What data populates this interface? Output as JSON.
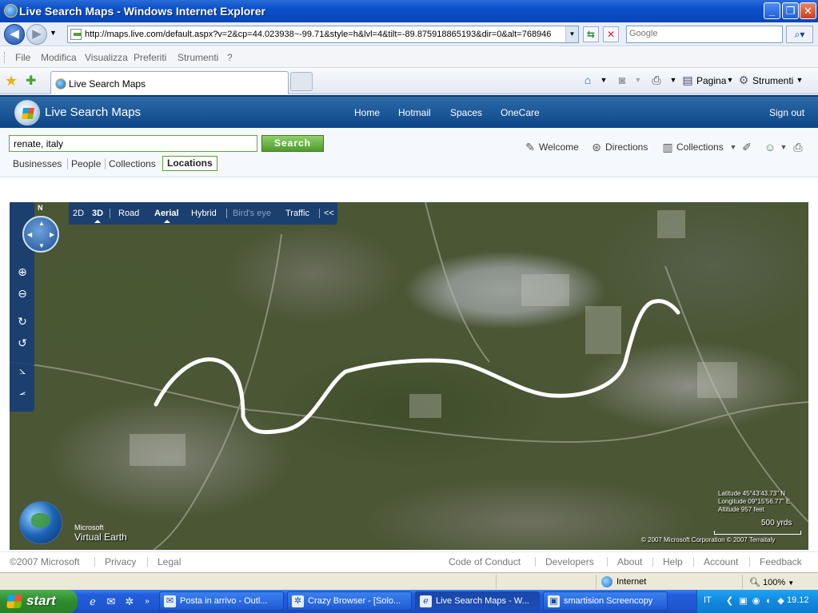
{
  "window": {
    "title": "Live Search Maps - Windows Internet Explorer",
    "minimize": "_",
    "restore": "❐",
    "close": "✕"
  },
  "address_bar": {
    "url": "http://maps.live.com/default.aspx?v=2&cp=44.023938~-99.71&style=h&lvl=4&tilt=-89.875918865193&dir=0&alt=768946",
    "search_placeholder": "Google"
  },
  "menu": [
    "File",
    "Modifica",
    "Visualizza",
    "Preferiti",
    "Strumenti",
    "?"
  ],
  "tab": {
    "label": "Live Search Maps"
  },
  "command_bar": {
    "page_label": "Pagina",
    "tools_label": "Strumenti"
  },
  "site": {
    "title": "Live Search Maps",
    "nav": [
      "Home",
      "Hotmail",
      "Spaces",
      "OneCare"
    ],
    "sign_out": "Sign out"
  },
  "search": {
    "query": "renate, italy",
    "button_label": "Search",
    "filters": [
      "Businesses",
      "People",
      "Collections"
    ],
    "active_filter": "Locations"
  },
  "tools": {
    "welcome": "Welcome",
    "directions": "Directions",
    "collections": "Collections"
  },
  "map": {
    "north": "N",
    "modes": {
      "view_2d": "2D",
      "view_3d": "3D",
      "road": "Road",
      "aerial": "Aerial",
      "hybrid": "Hybrid",
      "birds_eye": "Bird's eye",
      "traffic": "Traffic",
      "collapse": "<<"
    },
    "latitude": "Latitude 45°43'43.73\" N",
    "longitude": "Longitude 09°15'56.77\" E",
    "altitude": "Altitude 957 feet",
    "scale": "500 yrds",
    "copyright": "© 2007 Microsoft Corporation  © 2007 Terraitaly",
    "logo_microsoft": "Microsoft",
    "logo_name": "Virtual Earth"
  },
  "footer": {
    "copyright": "©2007 Microsoft",
    "left_links": [
      "Privacy",
      "Legal"
    ],
    "right_links": [
      "Code of Conduct",
      "Developers",
      "About",
      "Help",
      "Account",
      "Feedback"
    ]
  },
  "status_bar": {
    "zone": "Internet",
    "zoom": "100%"
  },
  "taskbar": {
    "start": "start",
    "tasks": [
      "Posta in arrivo - Outl...",
      "Crazy Browser - [Solo...",
      "Live Search Maps - W...",
      "smartision Screencopy"
    ],
    "language": "IT",
    "clock": "19.12"
  }
}
